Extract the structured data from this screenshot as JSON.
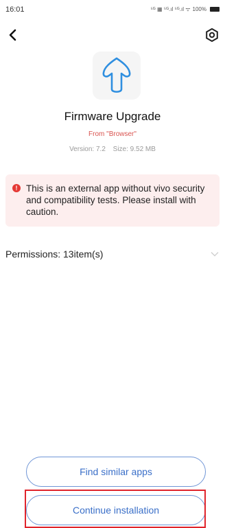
{
  "status_bar": {
    "time": "16:01",
    "icons_text": "⁵ᴳ ▦ ⁵ᴳ.ıl ⁵ᴳ.ıl ᯤ",
    "battery_percent": "100%"
  },
  "nav": {
    "back_icon": "chevron-left-icon",
    "settings_icon": "gear-icon"
  },
  "app": {
    "icon": "up-arrow-icon",
    "name": "Firmware Upgrade",
    "source": "From \"Browser\"",
    "version": "Version: 7.2",
    "size": "Size: 9.52 MB"
  },
  "warning": {
    "icon": "alert-icon",
    "text": "This is an external app without vivo security and compatibility tests. Please install with caution."
  },
  "permissions": {
    "label": "Permissions: 13item(s)"
  },
  "buttons": {
    "find_similar": "Find similar apps",
    "continue_install": "Continue installation"
  },
  "colors": {
    "accent": "#3a6fc8",
    "button_border": "#6f95d6",
    "warning_bg": "#fdeeee",
    "warning_icon": "#e53935",
    "source_text": "#d9534f",
    "highlight": "#e0232b"
  }
}
